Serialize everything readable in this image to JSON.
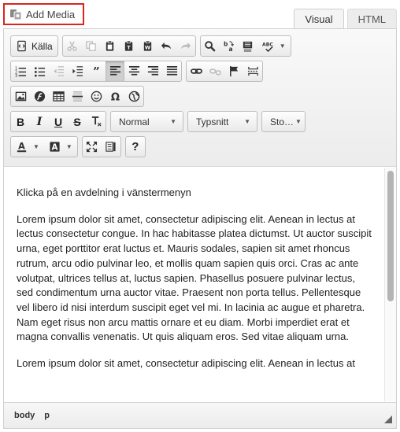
{
  "add_media_label": "Add Media",
  "tabs": [
    {
      "label": "Visual",
      "active": true
    },
    {
      "label": "HTML",
      "active": false
    }
  ],
  "toolbar": {
    "source_label": "Källa",
    "format_select": "Normal",
    "font_select": "Typsnitt",
    "size_select": "Sto…"
  },
  "content": {
    "paragraphs": [
      "Klicka på en avdelning i vänstermenyn",
      "Lorem ipsum dolor sit amet, consectetur adipiscing elit. Aenean in lectus at lectus consectetur congue. In hac habitasse platea dictumst. Ut auctor suscipit urna, eget porttitor erat luctus et. Mauris sodales, sapien sit amet rhoncus rutrum, arcu odio pulvinar leo, et mollis quam sapien quis orci. Cras ac ante volutpat, ultrices tellus at, luctus sapien. Phasellus posuere pulvinar lectus, sed condimentum urna auctor vitae. Praesent non porta tellus. Pellentesque vel libero id nisi interdum suscipit eget vel mi. In lacinia ac augue et pharetra. Nam eget risus non arcu mattis ornare et eu diam. Morbi imperdiet erat et magna convallis venenatis. Ut quis aliquam eros. Sed vitae aliquam urna.",
      "Lorem ipsum dolor sit amet, consectetur adipiscing elit. Aenean in lectus at"
    ]
  },
  "statusbar": {
    "path": [
      "body",
      "p"
    ]
  },
  "colors": {
    "highlight_border": "#d9261c",
    "toolbar_bg": "#ececec",
    "active_button": "#cfcfcf"
  }
}
